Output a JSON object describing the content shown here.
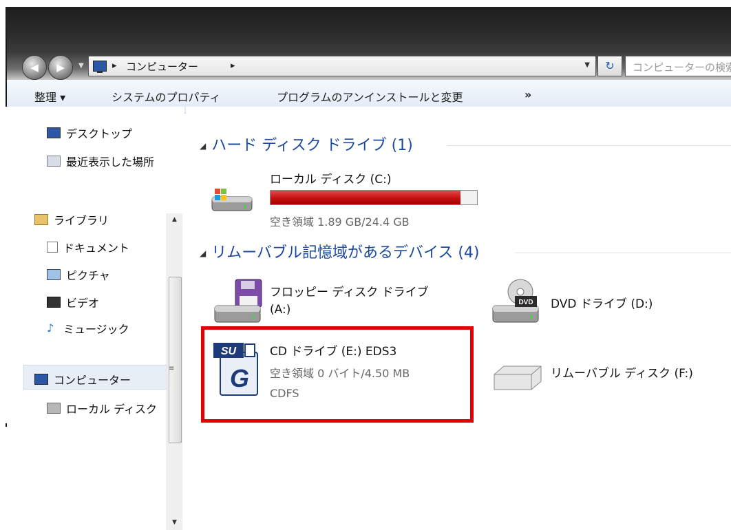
{
  "address_bar": {
    "crumb": "コンピューター",
    "search_placeholder": "コンピューターの検索"
  },
  "toolbar": {
    "organize": "整理 ▾",
    "system_properties": "システムのプロパティ",
    "uninstall": "プログラムのアンインストールと変更",
    "more": "»"
  },
  "sidebar": {
    "items": [
      {
        "label": "デスクトップ",
        "icon": "desktop-icon"
      },
      {
        "label": "最近表示した場所",
        "icon": "recent-places-icon"
      },
      {
        "label": "ライブラリ",
        "icon": "library-icon"
      },
      {
        "label": "ドキュメント",
        "icon": "document-icon"
      },
      {
        "label": "ピクチャ",
        "icon": "picture-icon"
      },
      {
        "label": "ビデオ",
        "icon": "video-icon"
      },
      {
        "label": "ミュージック",
        "icon": "music-icon"
      },
      {
        "label": "コンピューター",
        "icon": "computer-icon"
      },
      {
        "label": "ローカル ディスク",
        "icon": "local-disk-icon"
      }
    ]
  },
  "groups": {
    "hard_disk": "ハード ディスク ドライブ (1)",
    "removable": "リムーバブル記憶域があるデバイス (4)"
  },
  "drives": {
    "c": {
      "name": "ローカル ディスク (C:)",
      "space": "空き領域 1.89 GB/24.4 GB",
      "used_fraction": 0.92
    },
    "a": {
      "name_line1": "フロッピー ディスク ドライブ",
      "name_line2": "(A:)"
    },
    "d": {
      "name": "DVD ドライブ (D:)"
    },
    "e": {
      "name": "CD ドライブ (E:) EDS3",
      "space": "空き領域 0 バイト/4.50 MB",
      "fs": "CDFS"
    },
    "f": {
      "name": "リムーバブル ディスク (F:)"
    }
  },
  "colors": {
    "accent_blue": "#1d4a9c",
    "usage_bar_red": "#c41010",
    "highlight_red": "#e00000"
  }
}
